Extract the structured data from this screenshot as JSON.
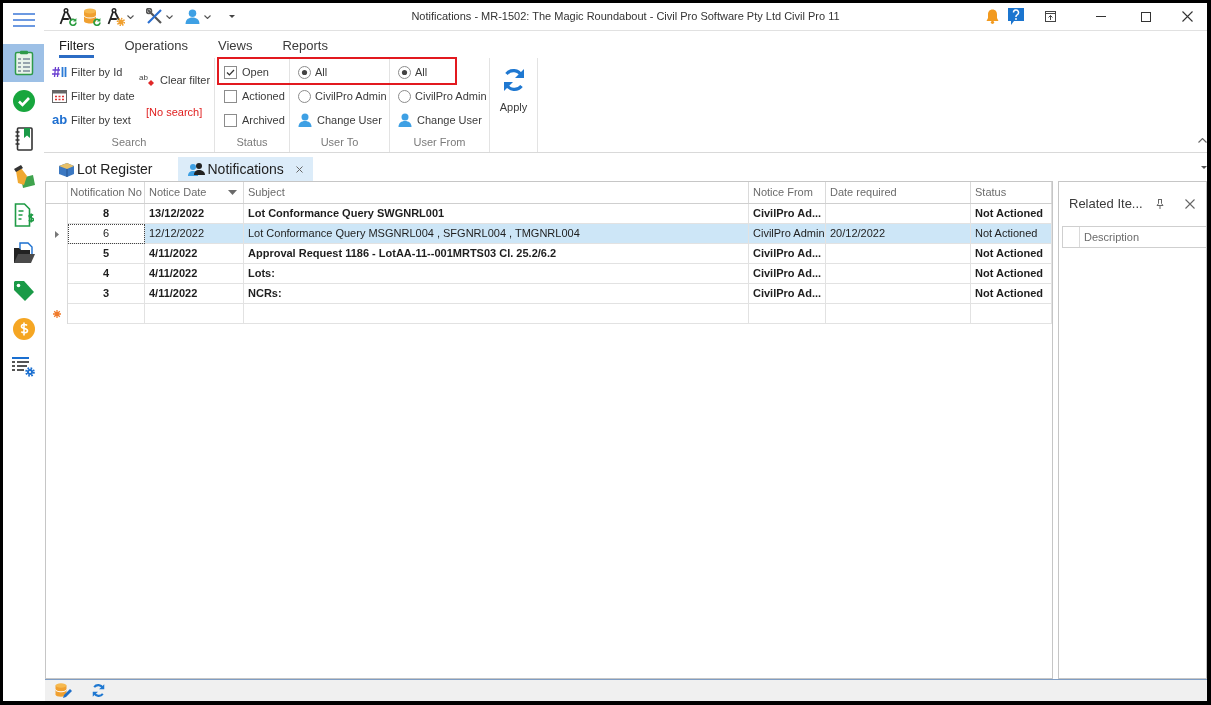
{
  "window": {
    "title": "Notifications - MR-1502: The Magic Roundabout - Civil Pro Software Pty Ltd Civil Pro 11"
  },
  "sidebar": {
    "items": [
      {
        "selected": true
      },
      {
        "selected": false
      },
      {
        "selected": false
      },
      {
        "selected": false
      },
      {
        "selected": false
      },
      {
        "selected": false
      },
      {
        "selected": false
      },
      {
        "selected": false
      },
      {
        "selected": false
      }
    ]
  },
  "ribbon": {
    "tabs": [
      {
        "label": "Filters",
        "selected": true
      },
      {
        "label": "Operations",
        "selected": false
      },
      {
        "label": "Views",
        "selected": false
      },
      {
        "label": "Reports",
        "selected": false
      }
    ],
    "search_group": {
      "label": "Search",
      "filter_buttons": [
        {
          "kind": "id",
          "label": "Filter by Id"
        },
        {
          "kind": "date",
          "label": "Filter by date"
        },
        {
          "kind": "text",
          "label": "Filter by text",
          "icon_text": "ab"
        }
      ],
      "clear_filter": {
        "label": "Clear filter",
        "icon_text": "ab"
      },
      "search_status": "[No search]"
    },
    "status_group": {
      "label": "Status",
      "options": [
        {
          "label": "Open",
          "checked": true
        },
        {
          "label": "Actioned",
          "checked": false
        },
        {
          "label": "Archived",
          "checked": false
        }
      ]
    },
    "user_to_group": {
      "label": "User To",
      "options": [
        {
          "label": "All",
          "selected": true
        },
        {
          "label": "CivilPro Admin",
          "selected": false
        }
      ],
      "change_user": "Change User"
    },
    "user_from_group": {
      "label": "User From",
      "options": [
        {
          "label": "All",
          "selected": true
        },
        {
          "label": "CivilPro Admin",
          "selected": false
        }
      ],
      "change_user": "Change User"
    },
    "apply_button": {
      "label": "Apply"
    }
  },
  "document_tabs": [
    {
      "label": "Lot Register",
      "selected": false,
      "closable": false
    },
    {
      "label": "Notifications",
      "selected": true,
      "closable": true
    }
  ],
  "notifications_grid": {
    "columns": [
      {
        "label": "Notification No"
      },
      {
        "label": "Notice Date",
        "sort_descending": true
      },
      {
        "label": "Subject"
      },
      {
        "label": "Notice From"
      },
      {
        "label": "Date required"
      },
      {
        "label": "Status"
      }
    ],
    "rows": [
      {
        "notification_no": "8",
        "notice_date": "13/12/2022",
        "subject": "Lot Conformance Query SWGNRL001",
        "notice_from": "CivilPro Ad...",
        "status": "Not Actioned",
        "unread": true,
        "selected": false
      },
      {
        "notification_no": "6",
        "notice_date": "12/12/2022",
        "subject": "Lot Conformance Query MSGNRL004 , SFGNRL004 , TMGNRL004",
        "notice_from": "CivilPro Admin",
        "date_required": "20/12/2022",
        "status": "Not Actioned",
        "unread": false,
        "selected": true
      },
      {
        "notification_no": "5",
        "notice_date": "4/11/2022",
        "subject": "Approval Request 1186 - LotAA-11--001MRTS03 Cl. 25.2/6.2",
        "notice_from": "CivilPro Ad...",
        "status": "Not Actioned",
        "unread": true,
        "selected": false
      },
      {
        "notification_no": "4",
        "notice_date": "4/11/2022",
        "subject": "Lots:",
        "notice_from": "CivilPro Ad...",
        "status": "Not Actioned",
        "unread": true,
        "selected": false
      },
      {
        "notification_no": "3",
        "notice_date": "4/11/2022",
        "subject": "NCRs:",
        "notice_from": "CivilPro Ad...",
        "status": "Not Actioned",
        "unread": true,
        "selected": false
      }
    ],
    "new_row": true
  },
  "related_items_panel": {
    "title": "Related Ite...",
    "columns": [
      {
        "label": "Description"
      }
    ]
  }
}
